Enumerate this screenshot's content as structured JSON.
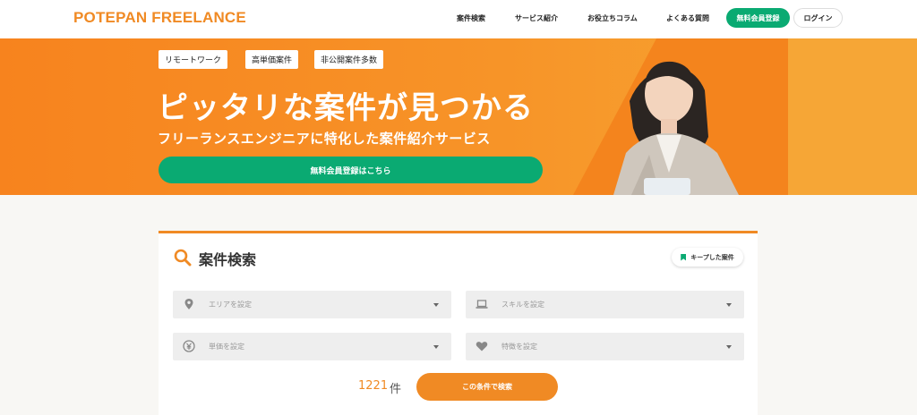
{
  "header": {
    "logo": "POTEPAN FREELANCE",
    "nav": [
      "案件検索",
      "サービス紹介",
      "お役立ちコラム",
      "よくある質問"
    ],
    "register_label": "無料会員登録",
    "login_label": "ログイン"
  },
  "hero": {
    "tags": [
      "リモートワーク",
      "高単価案件",
      "非公開案件多数"
    ],
    "title": "ピッタリな案件が見つかる",
    "subtitle": "フリーランスエンジニアに特化した案件紹介サービス",
    "cta_label": "無料会員登録はこちら"
  },
  "search": {
    "title": "案件検索",
    "keep_label": "キープした案件",
    "fields": {
      "area": {
        "placeholder": "エリアを設定",
        "icon": "location-pin-icon"
      },
      "skill": {
        "placeholder": "スキルを設定",
        "icon": "laptop-icon"
      },
      "price": {
        "placeholder": "単価を設定",
        "icon": "yen-icon"
      },
      "feature": {
        "placeholder": "特徴を設定",
        "icon": "heart-icon"
      }
    },
    "count": "1221",
    "count_unit": "件",
    "submit_label": "この条件で検索"
  },
  "colors": {
    "brand_orange": "#f08a24",
    "brand_green": "#0aaa72"
  }
}
